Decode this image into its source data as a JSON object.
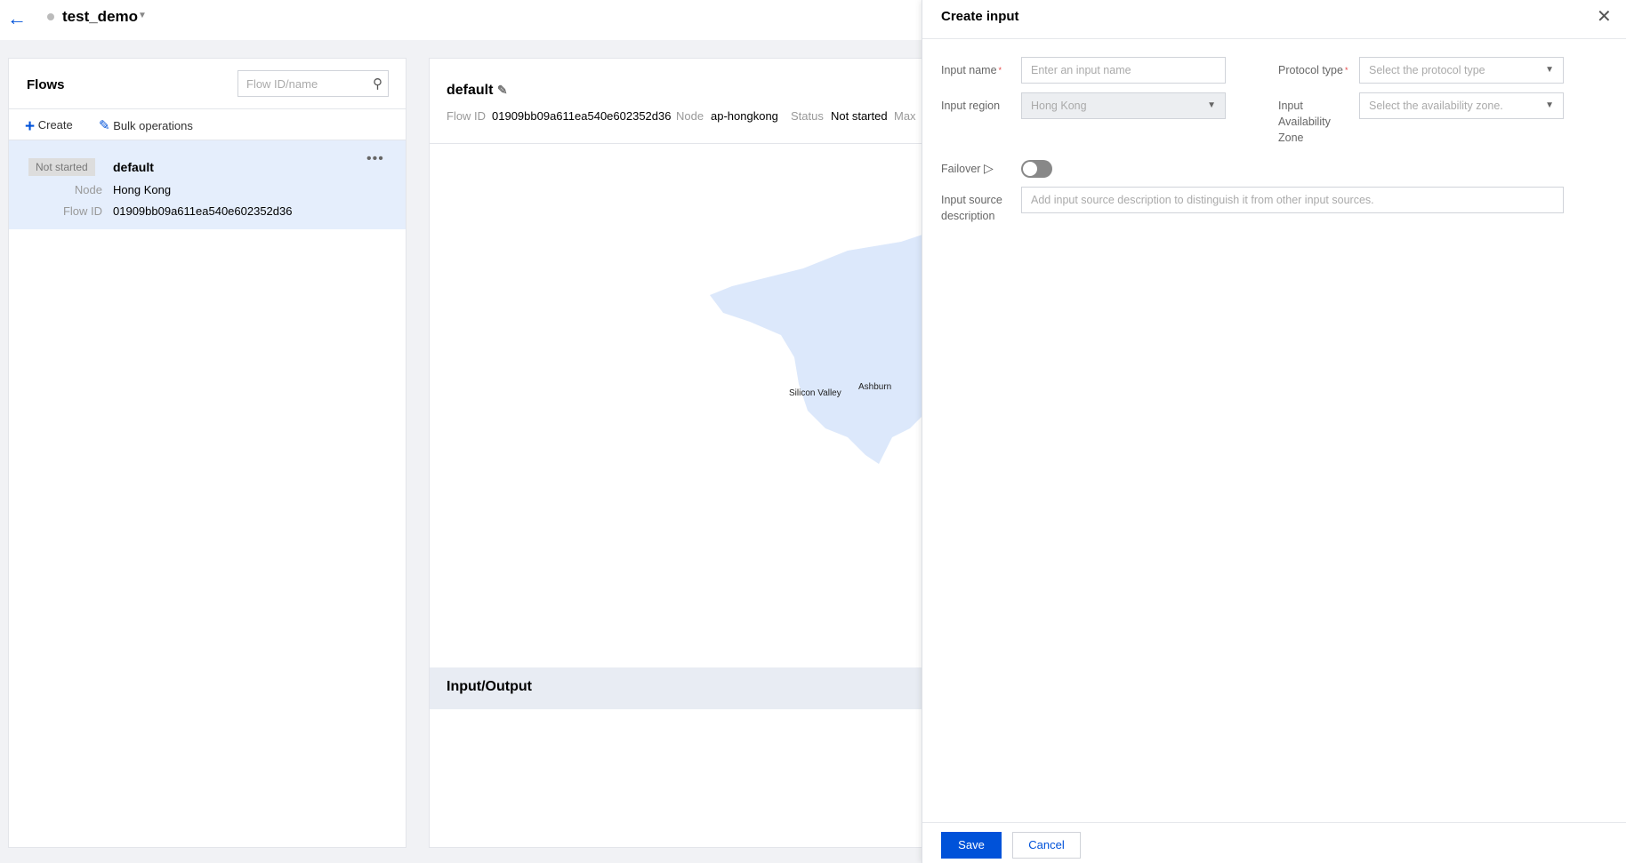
{
  "topbar": {
    "project": "test_demo"
  },
  "flows": {
    "title": "Flows",
    "search_placeholder": "Flow ID/name",
    "create_label": "Create",
    "bulk_label": "Bulk operations",
    "items": [
      {
        "status": "Not started",
        "name": "default",
        "node_label": "Node",
        "node": "Hong Kong",
        "flowid_label": "Flow ID",
        "flowid": "01909bb09a611ea540e602352d36"
      }
    ]
  },
  "detail": {
    "title": "default",
    "flowid_label": "Flow ID",
    "flowid": "01909bb09a611ea540e602352d36",
    "node_label": "Node",
    "node": "ap-hongkong",
    "status_label": "Status",
    "status": "Not started",
    "max_label": "Max",
    "map_labels": [
      "Silicon Valley",
      "Ashburn"
    ],
    "io_title": "Input/Output"
  },
  "drawer": {
    "title": "Create input",
    "input_name_label": "Input name",
    "input_name_placeholder": "Enter an input name",
    "protocol_label": "Protocol type",
    "protocol_placeholder": "Select the protocol type",
    "region_label": "Input region",
    "region_value": "Hong Kong",
    "az_label": "Input Availability Zone",
    "az_placeholder": "Select the availability zone.",
    "failover_label": "Failover",
    "failover_on": false,
    "desc_label": "Input source description",
    "desc_placeholder": "Add input source description to distinguish it from other input sources.",
    "save": "Save",
    "cancel": "Cancel"
  },
  "colors": {
    "primary": "#0052d9",
    "selected_row": "#e5eefc",
    "map_land": "#dce8fb"
  }
}
